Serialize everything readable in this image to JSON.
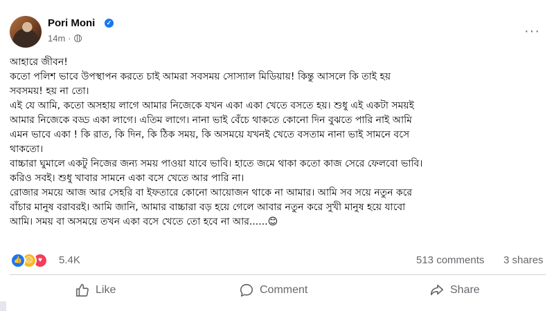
{
  "post": {
    "author": "Pori Moni",
    "verified": true,
    "time": "14m",
    "privacy_icon": "globe-icon",
    "menu_icon": "more-horizontal-icon",
    "lines": [
      "আহারে জীবন!",
      "কতো পলিশ ভাবে উপস্থাপন করতে চাই আমরা সবসময় সোস্যাল মিডিয়ায়! কিন্তু আসলে কি তাই হয়",
      "সবসময়! হয় না তো।",
      "এই যে আমি, কতো অসহায় লাগে আমার নিজেকে যখন একা একা খেতে বসতে হয়। শুধু এই একটা সময়ই",
      "আমার নিজেকে বড্ড একা লাগে। এতিম লাগে। নানা ভাই বেঁচে থাকতে কোনো দিন বুঝতে পারি নাই আমি",
      "এমন ভাবে একা ! কি রাত, কি দিন, কি ঠিক সময়, কি অসময়ে যখনই খেতে বসতাম নানা ভাই সামনে বসে",
      "থাকতো।",
      "বাচ্চারা ঘুমালে একটু নিজের জন্য সময় পাওয়া যাবে ভাবি। হাতে জমে থাকা কতো কাজ সেরে ফেলবো ভাবি।",
      "করিও সবই। শুধু খাবার সামনে একা বসে খেতে আর পারি না।",
      "রোজার সময়ে আজ আর সেহরি বা ইফতারে কোনো আয়োজন থাকে না আমার। আমি সব সয়ে নতুন করে",
      "বাঁচার মানুষ বরাবরই। আমি জানি, আমার বাচ্চারা বড় হয়ে গেলে আবার নতুন করে সুখী মানুষ হয়ে যাবো",
      "আমি। সময় বা অসময়ে তখন একা বসে খেতে তো হবে না আর......😊"
    ]
  },
  "engagement": {
    "reaction_icons": [
      "like-reaction-icon",
      "sad-reaction-icon",
      "love-reaction-icon"
    ],
    "reaction_count": "5.4K",
    "comments": "513 comments",
    "shares": "3 shares"
  },
  "actions": {
    "like": "Like",
    "comment": "Comment",
    "share": "Share"
  },
  "colors": {
    "accent": "#1877f2",
    "secondary_text": "#65676b",
    "love": "#f33e58",
    "sad": "#f7b928"
  }
}
